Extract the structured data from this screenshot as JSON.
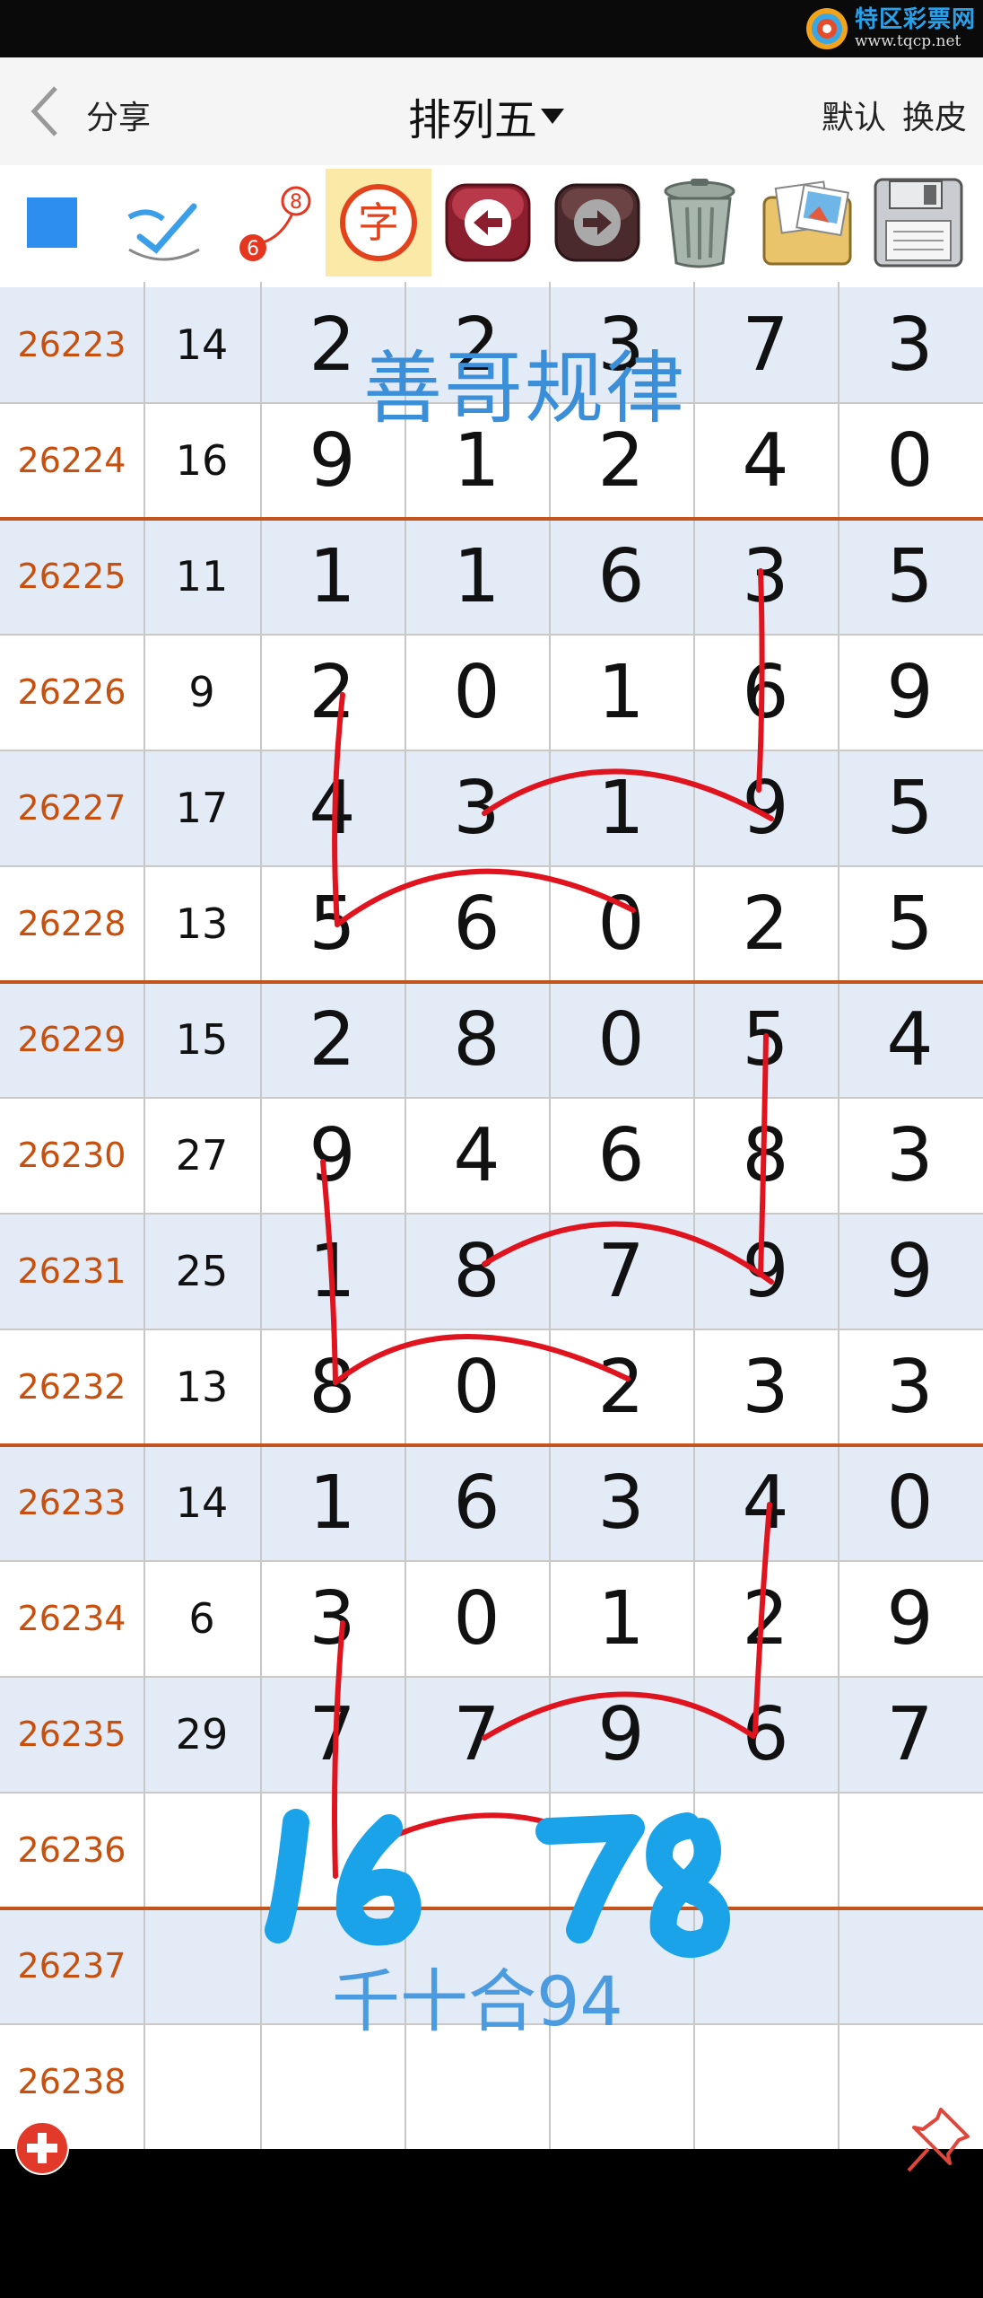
{
  "watermark": {
    "name": "特区彩票网",
    "url": "www.tqcp.net"
  },
  "nav": {
    "share": "分享",
    "title": "排列五",
    "default": "默认",
    "skin": "换皮"
  },
  "toolbar": {
    "tools": [
      {
        "name": "square-tool",
        "icon": "blue-square-icon"
      },
      {
        "name": "pen-tool",
        "icon": "pen-check-icon"
      },
      {
        "name": "connect-tool",
        "icon": "connect-icon",
        "labels": [
          "8",
          "6"
        ]
      },
      {
        "name": "text-tool",
        "icon": "text-icon",
        "label": "字"
      },
      {
        "name": "undo-tool",
        "icon": "arrow-left-icon"
      },
      {
        "name": "redo-tool",
        "icon": "arrow-right-icon"
      },
      {
        "name": "trash-tool",
        "icon": "trash-icon"
      },
      {
        "name": "album-tool",
        "icon": "photos-icon"
      },
      {
        "name": "save-tool",
        "icon": "floppy-icon"
      }
    ]
  },
  "rows": [
    {
      "issue": "26223",
      "sum": "14",
      "digits": [
        "2",
        "2",
        "3",
        "7",
        "3"
      ]
    },
    {
      "issue": "26224",
      "sum": "16",
      "digits": [
        "9",
        "1",
        "2",
        "4",
        "0"
      ]
    },
    {
      "issue": "26225",
      "sum": "11",
      "digits": [
        "1",
        "1",
        "6",
        "3",
        "5"
      ]
    },
    {
      "issue": "26226",
      "sum": "9",
      "digits": [
        "2",
        "0",
        "1",
        "6",
        "9"
      ]
    },
    {
      "issue": "26227",
      "sum": "17",
      "digits": [
        "4",
        "3",
        "1",
        "9",
        "5"
      ]
    },
    {
      "issue": "26228",
      "sum": "13",
      "digits": [
        "5",
        "6",
        "0",
        "2",
        "5"
      ]
    },
    {
      "issue": "26229",
      "sum": "15",
      "digits": [
        "2",
        "8",
        "0",
        "5",
        "4"
      ]
    },
    {
      "issue": "26230",
      "sum": "27",
      "digits": [
        "9",
        "4",
        "6",
        "8",
        "3"
      ]
    },
    {
      "issue": "26231",
      "sum": "25",
      "digits": [
        "1",
        "8",
        "7",
        "9",
        "9"
      ]
    },
    {
      "issue": "26232",
      "sum": "13",
      "digits": [
        "8",
        "0",
        "2",
        "3",
        "3"
      ]
    },
    {
      "issue": "26233",
      "sum": "14",
      "digits": [
        "1",
        "6",
        "3",
        "4",
        "0"
      ]
    },
    {
      "issue": "26234",
      "sum": "6",
      "digits": [
        "3",
        "0",
        "1",
        "2",
        "9"
      ]
    },
    {
      "issue": "26235",
      "sum": "29",
      "digits": [
        "7",
        "7",
        "9",
        "6",
        "7"
      ]
    },
    {
      "issue": "26236",
      "sum": "",
      "digits": [
        "",
        "",
        "",
        "",
        ""
      ]
    },
    {
      "issue": "26237",
      "sum": "",
      "digits": [
        "",
        "",
        "",
        "",
        ""
      ]
    },
    {
      "issue": "26238",
      "sum": "",
      "digits": [
        "",
        "",
        "",
        "",
        ""
      ]
    }
  ],
  "annotations": {
    "title": "善哥规律",
    "prediction_left": "16",
    "prediction_right": "78",
    "sum_note": "千十合94"
  },
  "colors": {
    "issue": "#c8500f",
    "separator": "#c2541e",
    "stripe": "#e3ebf7",
    "annotation_blue": "#1aa3e8",
    "annotation_red": "#e0141e"
  },
  "buttons": {
    "add_icon": "plus-circle-icon",
    "pin_icon": "pushpin-icon"
  }
}
